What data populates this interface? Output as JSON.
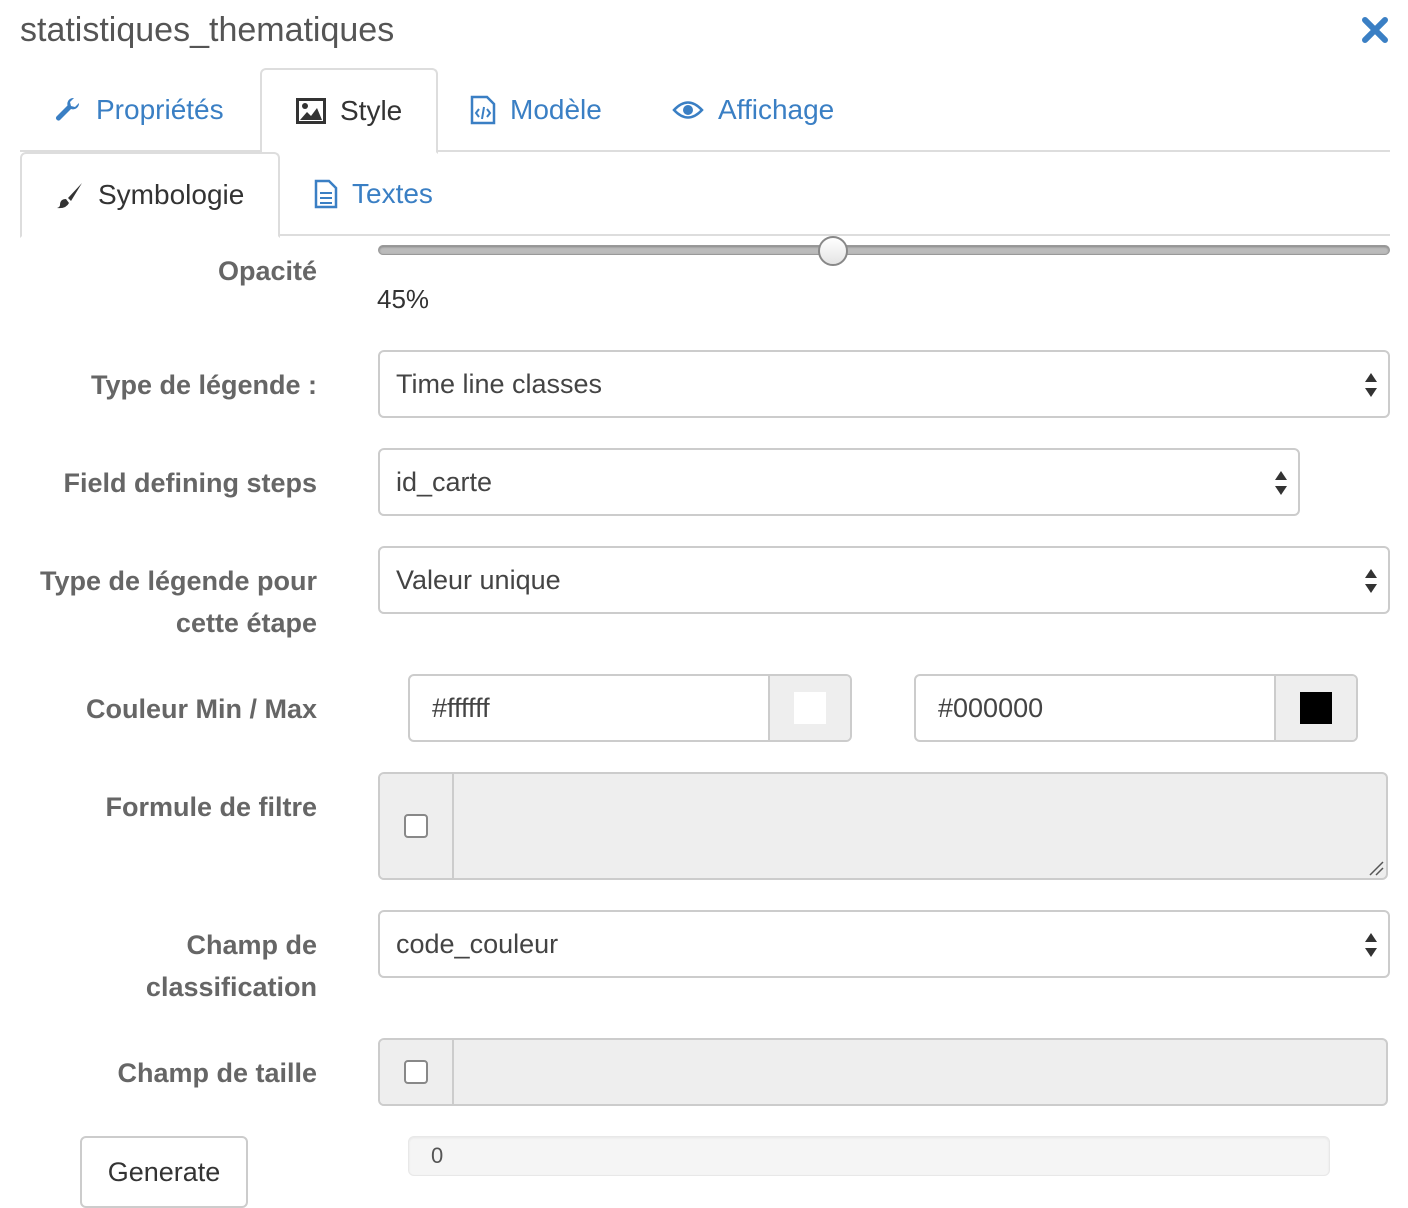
{
  "dialog": {
    "title": "statistiques_thematiques"
  },
  "tabs": [
    {
      "label": "Propriétés",
      "icon": "wrench-icon"
    },
    {
      "label": "Style",
      "icon": "image-icon",
      "active": true
    },
    {
      "label": "Modèle",
      "icon": "code-file-icon"
    },
    {
      "label": "Affichage",
      "icon": "eye-icon"
    }
  ],
  "subtabs": [
    {
      "label": "Symbologie",
      "icon": "paintbrush-icon",
      "active": true
    },
    {
      "label": "Textes",
      "icon": "document-icon"
    }
  ],
  "form": {
    "opacity": {
      "label": "Opacité",
      "value_text": "45%",
      "value": 45
    },
    "legend_type": {
      "label": "Type de légende :",
      "value": "Time line classes"
    },
    "step_field": {
      "label": "Field defining steps",
      "value": "id_carte"
    },
    "step_legend_type": {
      "label_line1": "Type de légende pour",
      "label_line2": "cette étape",
      "value": "Valeur unique"
    },
    "colors": {
      "label": "Couleur Min / Max",
      "min": "#ffffff",
      "max": "#000000"
    },
    "filter": {
      "label": "Formule de filtre",
      "checked": false,
      "value": ""
    },
    "class_field": {
      "label_line1": "Champ de",
      "label_line2": "classification",
      "value": "code_couleur"
    },
    "size_field": {
      "label": "Champ de taille",
      "checked": false,
      "value": ""
    },
    "generate": {
      "label": "Generate"
    },
    "progress": {
      "text": "0",
      "value": 0
    }
  },
  "colors": {
    "link": "#3a7fc4",
    "label": "#666666",
    "border": "#cccccc"
  }
}
